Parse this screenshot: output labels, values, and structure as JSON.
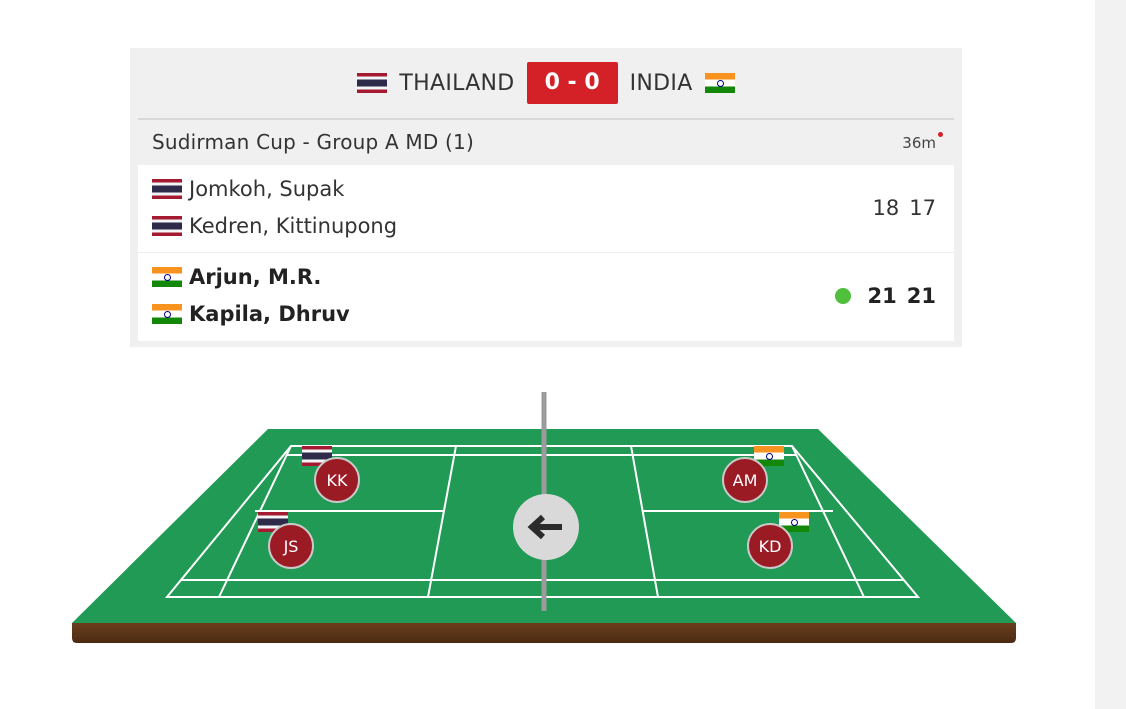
{
  "header": {
    "home_team": "THAILAND",
    "away_team": "INDIA",
    "score": "0 - 0"
  },
  "event": {
    "title": "Sudirman Cup - Group A MD (1)",
    "elapsed": "36m"
  },
  "match": {
    "top_pair": {
      "country": "thailand",
      "players": [
        "Jomkoh, Supak",
        "Kedren, Kittinupong"
      ],
      "games": [
        "18",
        "17"
      ]
    },
    "bottom_pair": {
      "country": "india",
      "players": [
        "Arjun, M.R.",
        "Kapila, Dhruv"
      ],
      "games": [
        "21",
        "21"
      ],
      "serving": true,
      "winner": true
    }
  },
  "court": {
    "tokens": [
      {
        "initials": "KK",
        "country": "thailand"
      },
      {
        "initials": "JS",
        "country": "thailand"
      },
      {
        "initials": "AM",
        "country": "india"
      },
      {
        "initials": "KD",
        "country": "india"
      }
    ],
    "direction_icon": "arrow-left-icon"
  },
  "colors": {
    "accent_red": "#d42027",
    "court_green": "#219a55",
    "token_red": "#9b1b25",
    "serve_green": "#4fbf3c"
  }
}
